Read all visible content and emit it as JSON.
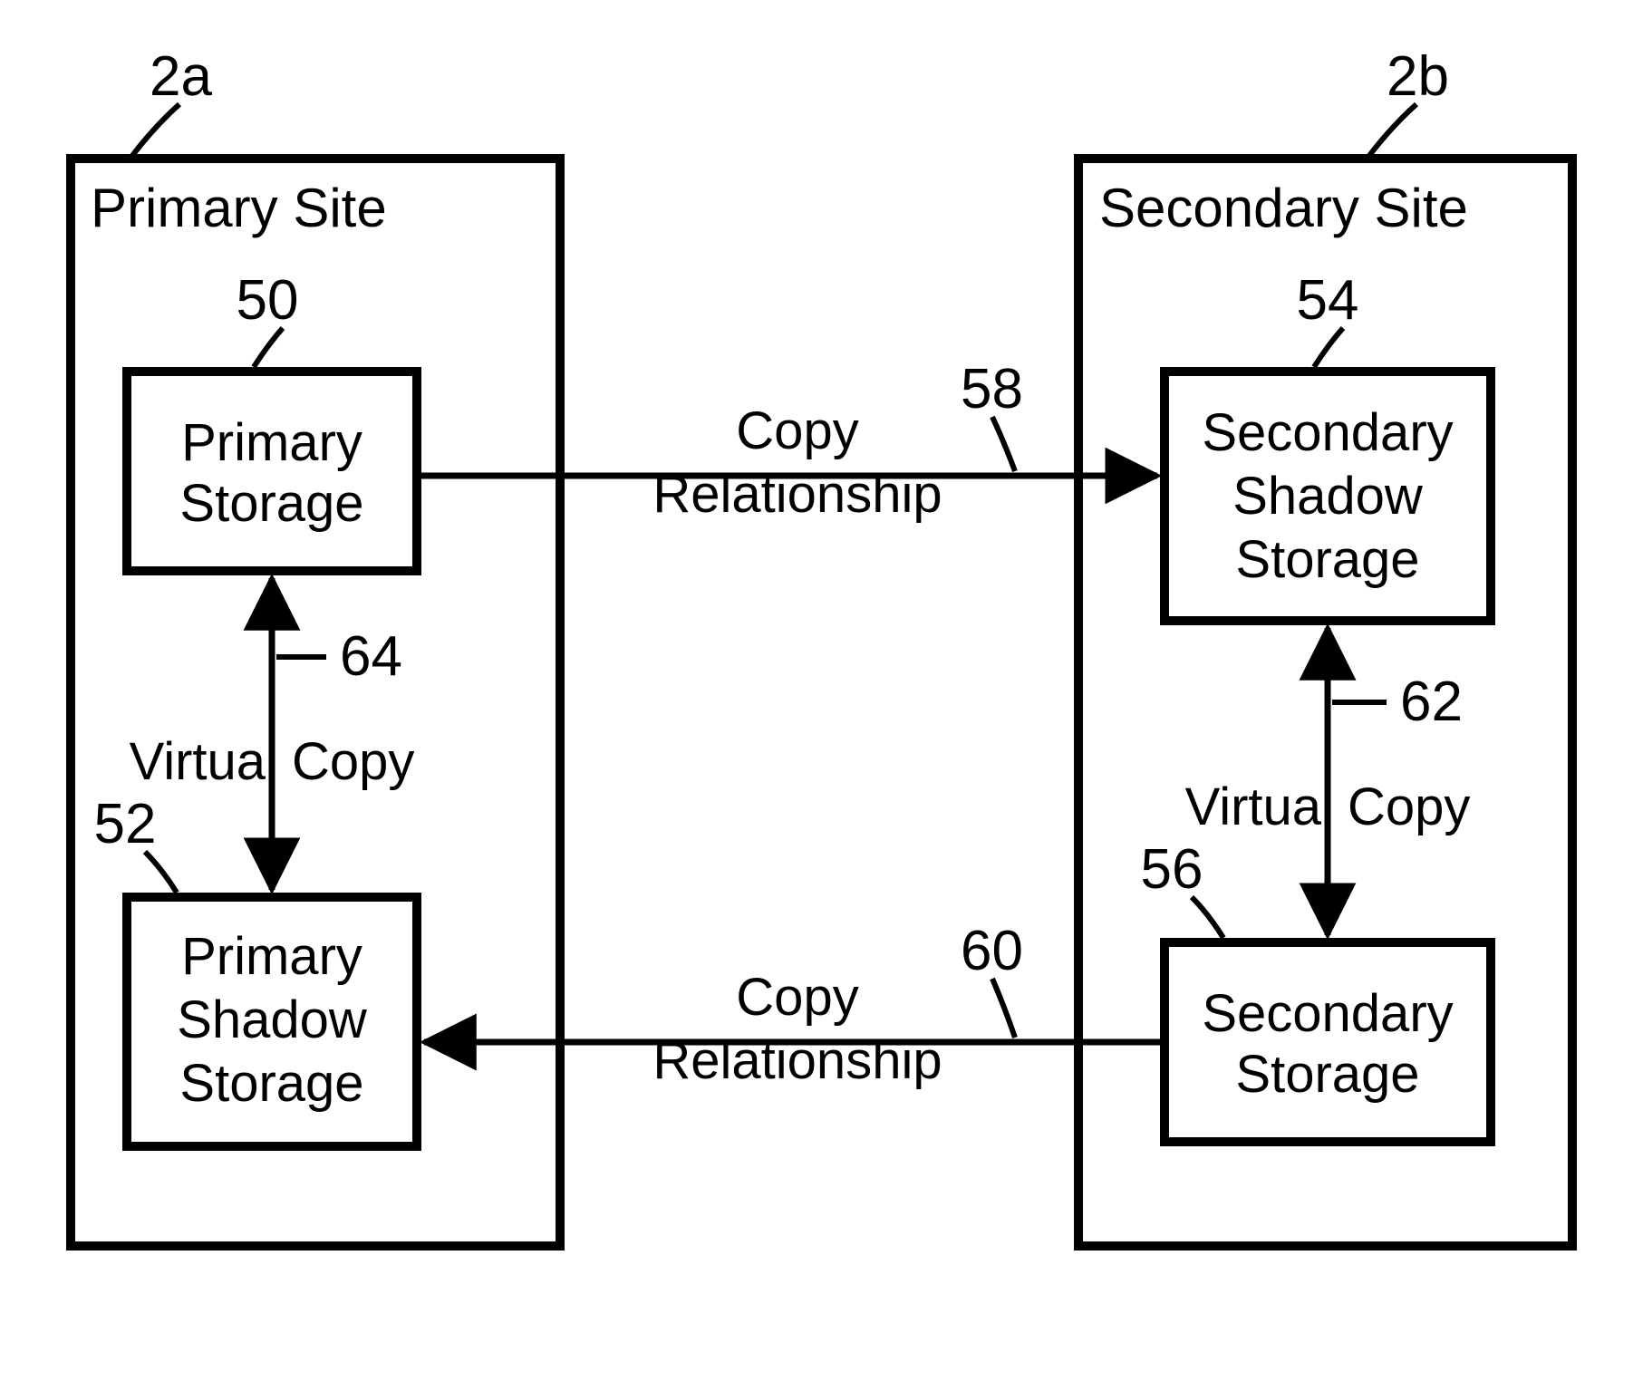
{
  "primary_site": {
    "ref": "2a",
    "title": "Primary Site",
    "boxes": {
      "storage": {
        "ref": "50",
        "line1": "Primary",
        "line2": "Storage"
      },
      "shadow_storage": {
        "ref": "52",
        "line1": "Primary",
        "line2": "Shadow",
        "line3": "Storage"
      }
    },
    "virtual_copy": {
      "ref": "64",
      "label": "Virtual Copy"
    }
  },
  "secondary_site": {
    "ref": "2b",
    "title": "Secondary Site",
    "boxes": {
      "shadow_storage": {
        "ref": "54",
        "line1": "Secondary",
        "line2": "Shadow",
        "line3": "Storage"
      },
      "storage": {
        "ref": "56",
        "line1": "Secondary",
        "line2": "Storage"
      }
    },
    "virtual_copy": {
      "ref": "62",
      "label": "Virtual Copy"
    }
  },
  "copy_rel_top": {
    "ref": "58",
    "line1": "Copy",
    "line2": "Relationship"
  },
  "copy_rel_bottom": {
    "ref": "60",
    "line1": "Copy",
    "line2": "Relationship"
  }
}
